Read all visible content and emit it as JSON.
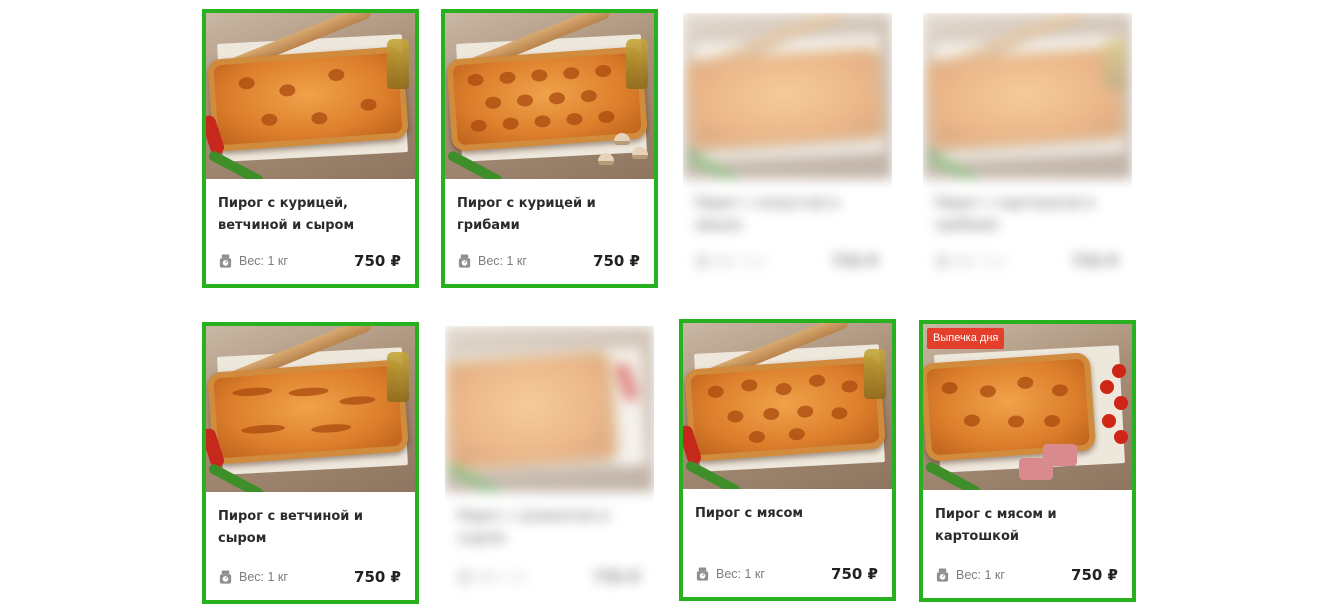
{
  "colors": {
    "highlight_border": "#27b11e",
    "badge_bg": "#e43f2b"
  },
  "products": [
    {
      "title": "Пирог с курицей, ветчиной и сыром",
      "weight": "Вес: 1 кг",
      "price": "750 ₽",
      "badge": "",
      "highlighted": true
    },
    {
      "title": "Пирог с курицей и грибами",
      "weight": "Вес: 1 кг",
      "price": "750 ₽",
      "badge": "",
      "highlighted": true
    },
    {
      "title": "Пирог с капустой и яйцом",
      "weight": "Вес: 1 кг",
      "price": "750 ₽",
      "badge": "",
      "highlighted": false
    },
    {
      "title": "Пирог с картошкой и грибами",
      "weight": "Вес: 1 кг",
      "price": "750 ₽",
      "badge": "",
      "highlighted": false
    },
    {
      "title": "Пирог с ветчиной и сыром",
      "weight": "Вес: 1 кг",
      "price": "750 ₽",
      "badge": "",
      "highlighted": true
    },
    {
      "title": "Пирог с шпинатом и сыром",
      "weight": "Вес: 1 кг",
      "price": "750 ₽",
      "badge": "",
      "highlighted": false
    },
    {
      "title": "Пирог с мясом",
      "weight": "Вес: 1 кг",
      "price": "750 ₽",
      "badge": "",
      "highlighted": true
    },
    {
      "title": "Пирог с мясом и картошкой",
      "weight": "Вес: 1 кг",
      "price": "750 ₽",
      "badge": "Выпечка дня",
      "highlighted": true
    }
  ]
}
